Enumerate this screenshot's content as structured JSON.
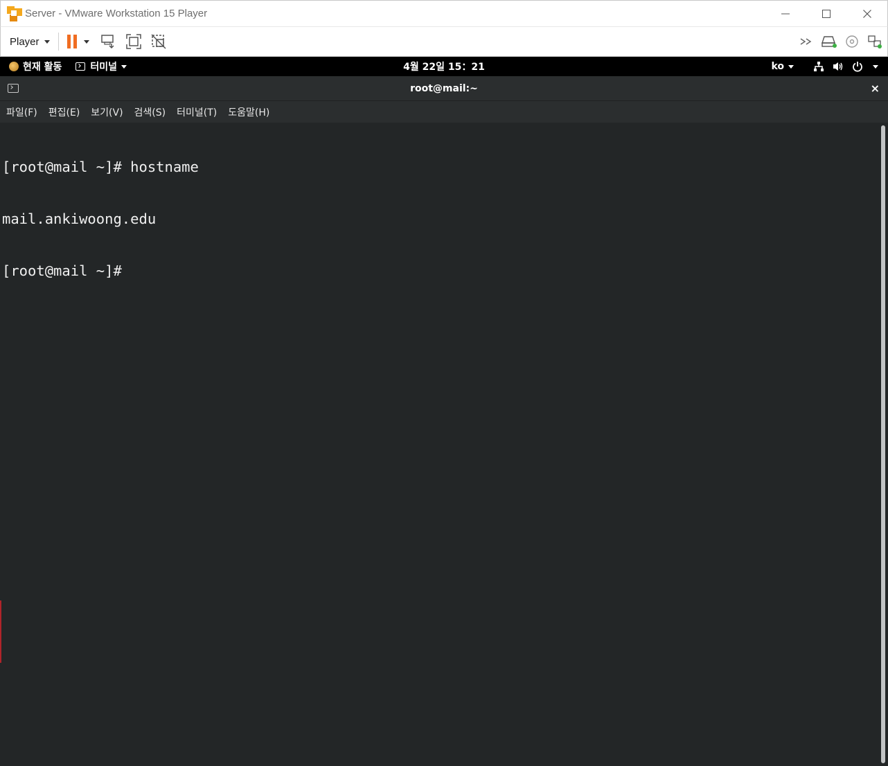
{
  "window": {
    "title": "Server - VMware Workstation 15 Player"
  },
  "toolbar": {
    "player_label": "Player"
  },
  "gnome": {
    "activities_label": "현재 활동",
    "app_label": "터미널",
    "clock": "4월 22일  15：21",
    "language": "ko"
  },
  "terminal": {
    "title": "root@mail:~",
    "close_glyph": "×",
    "menu": [
      {
        "label": "파일(F)"
      },
      {
        "label": "편집(E)"
      },
      {
        "label": "보기(V)"
      },
      {
        "label": "검색(S)"
      },
      {
        "label": "터미널(T)"
      },
      {
        "label": "도움말(H)"
      }
    ],
    "lines": [
      "[root@mail ~]# hostname",
      "mail.ankiwoong.edu",
      "[root@mail ~]# "
    ]
  },
  "colors": {
    "pause_accent": "#f06d22",
    "terminal_bg": "#232627",
    "header_bg": "#2b2e2f",
    "vmware_logo": "#f4a81d"
  },
  "icons": {
    "app": "vmware-logo-icon",
    "pause": "pause-icon",
    "send_ctrl_alt_del": "send-ctrl-alt-del-icon",
    "fullscreen": "fullscreen-icon",
    "unity": "unity-icon",
    "more": "double-chevron-icon",
    "hdd": "hard-disk-icon",
    "cd": "cd-icon",
    "network": "network-adapter-icon"
  }
}
